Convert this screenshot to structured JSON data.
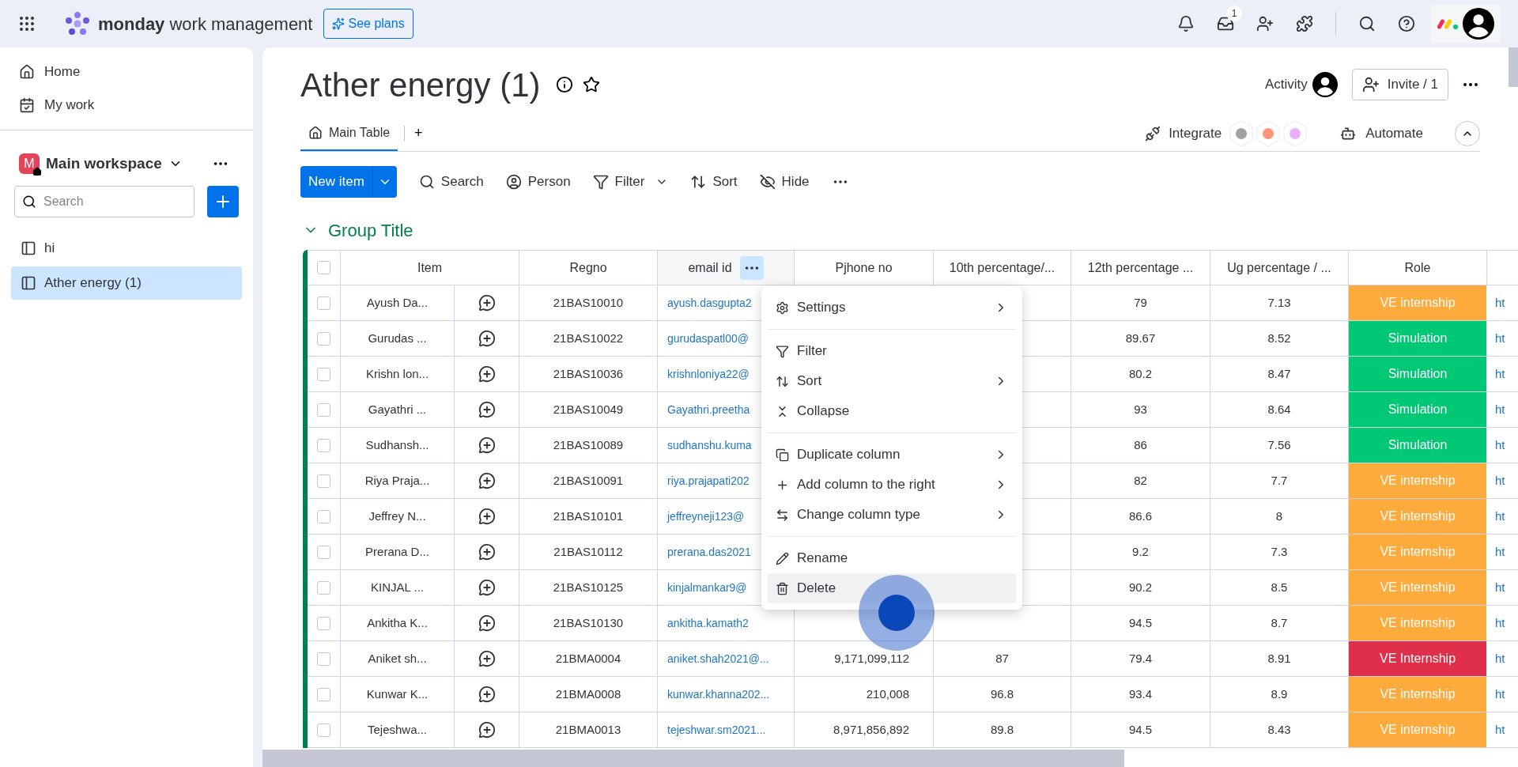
{
  "topbar": {
    "brand_bold": "monday",
    "brand_rest": "work management",
    "plans_button": "See plans",
    "inbox_badge": "1"
  },
  "sidebar": {
    "nav": [
      {
        "label": "Home"
      },
      {
        "label": "My work"
      }
    ],
    "workspace": {
      "initial": "M",
      "name": "Main workspace"
    },
    "search": {
      "placeholder": "Search"
    },
    "boards": [
      {
        "label": "hi",
        "selected": false
      },
      {
        "label": "Ather energy (1)",
        "selected": true
      }
    ]
  },
  "board": {
    "title": "Ather energy (1)",
    "activity": "Activity",
    "invite": "Invite / 1",
    "tabs": [
      {
        "label": "Main Table",
        "selected": true
      }
    ],
    "add_tab": "+",
    "integrate": "Integrate",
    "automate": "Automate"
  },
  "toolbar": {
    "new_item": "New item",
    "actions": [
      {
        "label": "Search",
        "has_caret": false
      },
      {
        "label": "Person",
        "has_caret": false
      },
      {
        "label": "Filter",
        "has_caret": true
      },
      {
        "label": "Sort",
        "has_caret": false
      },
      {
        "label": "Hide",
        "has_caret": false
      }
    ]
  },
  "group": {
    "title": "Group Title",
    "expanded": true
  },
  "table": {
    "all_checked": false,
    "columns": [
      {
        "label": "Item",
        "menu_open": false
      },
      {
        "label": "Regno",
        "menu_open": false
      },
      {
        "label": "email id",
        "menu_open": true
      },
      {
        "label": "Pjhone no",
        "menu_open": false
      },
      {
        "label": "10th percentage/...",
        "menu_open": false
      },
      {
        "label": "12th percentage ...",
        "menu_open": false
      },
      {
        "label": "Ug percentage / ...",
        "menu_open": false
      },
      {
        "label": "Role",
        "menu_open": false
      }
    ],
    "rows": [
      {
        "name": "Ayush Da...",
        "regno": "21BAS10010",
        "email": "ayush.dasgupta2",
        "twelfth": "79",
        "ug": "7.13",
        "role": "VE internship",
        "color": "#fdab3d",
        "column_10": "ht",
        "checked": false
      },
      {
        "name": "Gurudas ...",
        "regno": "21BAS10022",
        "email": "gurudaspatl00@",
        "twelfth": "89.67",
        "ug": "8.52",
        "role": "Simulation",
        "color": "#00c875",
        "column_10": "ht",
        "checked": false
      },
      {
        "name": "Krishn lon...",
        "regno": "21BAS10036",
        "email": "krishnloniya22@",
        "twelfth": "80.2",
        "ug": "8.47",
        "role": "Simulation",
        "color": "#00c875",
        "column_10": "ht",
        "checked": false
      },
      {
        "name": "Gayathri ...",
        "regno": "21BAS10049",
        "email": "Gayathri.preetha",
        "twelfth": "93",
        "ug": "8.64",
        "role": "Simulation",
        "color": "#00c875",
        "column_10": "ht",
        "checked": false
      },
      {
        "name": "Sudhansh...",
        "regno": "21BAS10089",
        "email": "sudhanshu.kuma",
        "twelfth": "86",
        "ug": "7.56",
        "role": "Simulation",
        "color": "#00c875",
        "column_10": "ht",
        "checked": false
      },
      {
        "name": "Riya Praja...",
        "regno": "21BAS10091",
        "email": "riya.prajapati202",
        "twelfth": "82",
        "ug": "7.7",
        "role": "VE internship",
        "color": "#fdab3d",
        "column_10": "ht",
        "checked": false
      },
      {
        "name": "Jeffrey N...",
        "regno": "21BAS10101",
        "email": "jeffreyneji123@",
        "twelfth": "86.6",
        "ug": "8",
        "role": "VE internship",
        "color": "#fdab3d",
        "column_10": "ht",
        "checked": false
      },
      {
        "name": "Prerana D...",
        "regno": "21BAS10112",
        "email": "prerana.das2021",
        "twelfth": "9.2",
        "ug": "7.3",
        "role": "VE internship",
        "color": "#fdab3d",
        "column_10": "ht",
        "checked": false
      },
      {
        "name": "KINJAL ...",
        "regno": "21BAS10125",
        "email": "kinjalmankar9@",
        "twelfth": "90.2",
        "ug": "8.5",
        "role": "VE internship",
        "color": "#fdab3d",
        "column_10": "ht",
        "checked": false
      },
      {
        "name": "Ankitha K...",
        "regno": "21BAS10130",
        "email": "ankitha.kamath2",
        "twelfth": "94.5",
        "ug": "8.7",
        "role": "VE internship",
        "color": "#fdab3d",
        "column_10": "ht",
        "checked": false
      },
      {
        "name": "Aniket sh...",
        "regno": "21BMA0004",
        "email": "aniket.shah2021@...",
        "phone": "9,171,099,112",
        "tenth": "87",
        "twelfth": "79.4",
        "ug": "8.91",
        "role": "VE Internship",
        "color": "#df2f4a",
        "column_10": "ht",
        "checked": false
      },
      {
        "name": "Kunwar K...",
        "regno": "21BMA0008",
        "email": "kunwar.khanna202...",
        "phone": "210,008",
        "tenth": "96.8",
        "twelfth": "93.4",
        "ug": "8.9",
        "role": "VE internship",
        "color": "#fdab3d",
        "column_10": "ht",
        "checked": false
      },
      {
        "name": "Tejeshwa...",
        "regno": "21BMA0013",
        "email": "tejeshwar.sm2021...",
        "phone": "8,971,856,892",
        "tenth": "89.8",
        "twelfth": "94.5",
        "ug": "8.43",
        "role": "VE internship",
        "color": "#fdab3d",
        "column_10": "ht",
        "checked": false
      }
    ]
  },
  "column_menu": {
    "sections": [
      [
        {
          "kind": "settings",
          "label": "Settings",
          "has_submenu": true,
          "highlighted": false
        }
      ],
      [
        {
          "kind": "filter",
          "label": "Filter",
          "has_submenu": false,
          "highlighted": false
        },
        {
          "kind": "sort",
          "label": "Sort",
          "has_submenu": true,
          "highlighted": false
        },
        {
          "kind": "collapse",
          "label": "Collapse",
          "has_submenu": false,
          "highlighted": false
        }
      ],
      [
        {
          "kind": "duplicate",
          "label": "Duplicate column",
          "has_submenu": true,
          "highlighted": false
        },
        {
          "kind": "add",
          "label": "Add column to the right",
          "has_submenu": true,
          "highlighted": false
        },
        {
          "kind": "change",
          "label": "Change column type",
          "has_submenu": true,
          "highlighted": false
        }
      ],
      [
        {
          "kind": "rename",
          "label": "Rename",
          "has_submenu": false,
          "highlighted": false
        },
        {
          "kind": "delete",
          "label": "Delete",
          "has_submenu": false,
          "highlighted": true
        }
      ]
    ]
  }
}
